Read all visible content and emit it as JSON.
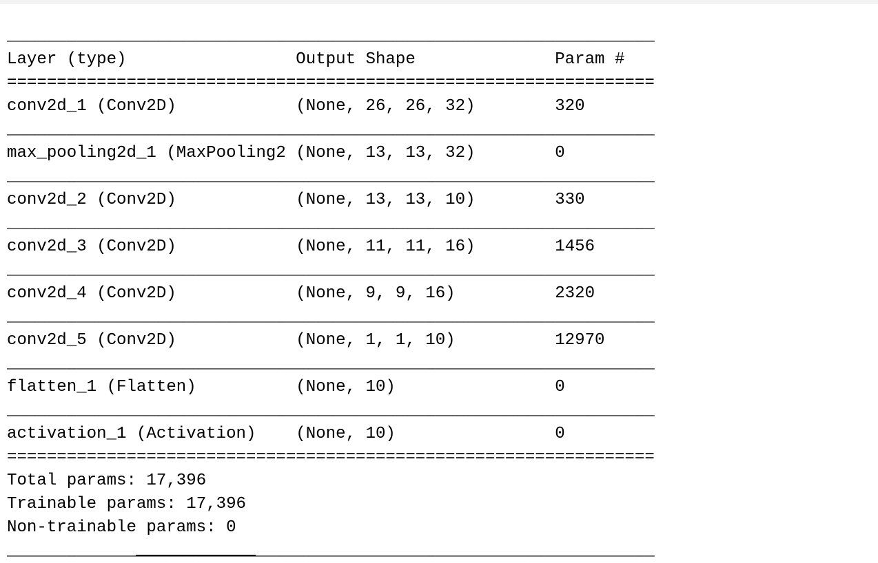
{
  "summary": {
    "rule_line": "_________________________________________________________________",
    "double_rule_line": "=================================================================",
    "header": "Layer (type)                 Output Shape              Param #   ",
    "rows": [
      "conv2d_1 (Conv2D)            (None, 26, 26, 32)        320       ",
      "max_pooling2d_1 (MaxPooling2 (None, 13, 13, 32)        0         ",
      "conv2d_2 (Conv2D)            (None, 13, 13, 10)        330       ",
      "conv2d_3 (Conv2D)            (None, 11, 11, 16)        1456      ",
      "conv2d_4 (Conv2D)            (None, 9, 9, 16)          2320      ",
      "conv2d_5 (Conv2D)            (None, 1, 1, 10)          12970     ",
      "flatten_1 (Flatten)          (None, 10)                0         ",
      "activation_1 (Activation)    (None, 10)                0         "
    ],
    "total_params": "Total params: 17,396",
    "trainable_params": "Trainable params: 17,396",
    "non_trainable_params": "Non-trainable params: 0"
  }
}
